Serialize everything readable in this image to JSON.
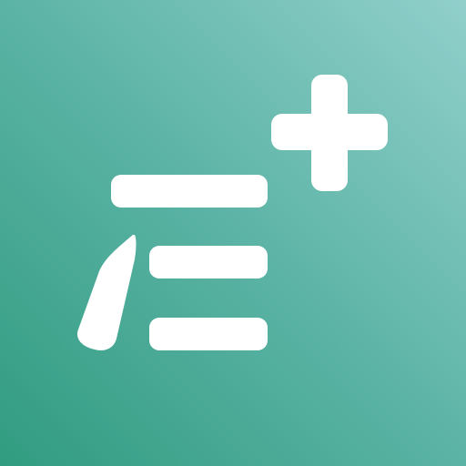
{
  "icon": {
    "name": "add-note-icon",
    "glyphs": [
      "pen-icon",
      "text-lines-icon",
      "plus-icon"
    ],
    "colors": {
      "gradient_top_right": "#91CFCB",
      "gradient_middle": "#5BB3A5",
      "gradient_bottom_left": "#319C80",
      "glyph": "#FFFFFF"
    }
  }
}
